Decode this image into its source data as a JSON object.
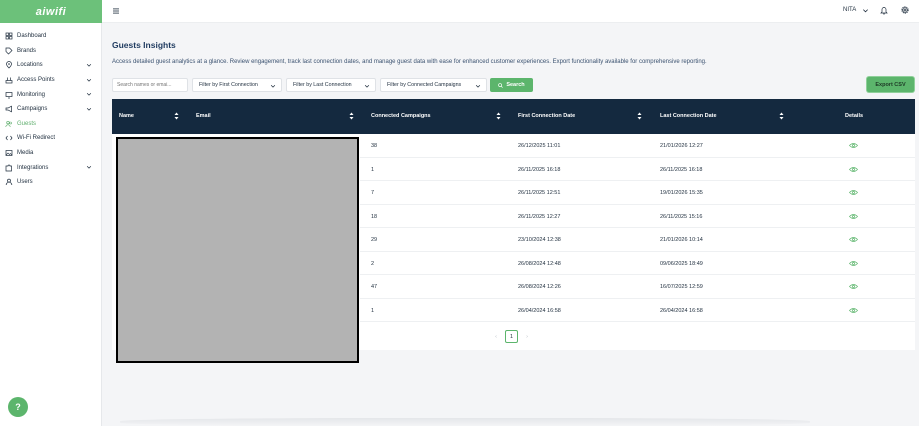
{
  "brand": {
    "name": "aiwifi",
    "accent": "#5cb56c",
    "header_bg": "#14293f"
  },
  "sidebar": {
    "items": [
      {
        "label": "Dashboard",
        "icon": "grid-icon",
        "has_children": false,
        "active": false
      },
      {
        "label": "Brands",
        "icon": "tag-icon",
        "has_children": false,
        "active": false
      },
      {
        "label": "Locations",
        "icon": "location-pin-icon",
        "has_children": true,
        "active": false
      },
      {
        "label": "Access Points",
        "icon": "router-icon",
        "has_children": true,
        "active": false
      },
      {
        "label": "Monitoring",
        "icon": "monitor-icon",
        "has_children": true,
        "active": false
      },
      {
        "label": "Campaigns",
        "icon": "megaphone-icon",
        "has_children": true,
        "active": false
      },
      {
        "label": "Guests",
        "icon": "users-icon",
        "has_children": false,
        "active": true
      },
      {
        "label": "Wi-Fi Redirect",
        "icon": "redirect-icon",
        "has_children": false,
        "active": false
      },
      {
        "label": "Media",
        "icon": "image-icon",
        "has_children": false,
        "active": false
      },
      {
        "label": "Integrations",
        "icon": "puzzle-icon",
        "has_children": true,
        "active": false
      },
      {
        "label": "Users",
        "icon": "user-icon",
        "has_children": false,
        "active": false
      }
    ],
    "help_label": "?"
  },
  "topbar": {
    "user_name": "NITA",
    "menu_icon": "hamburger-icon",
    "notification_icon": "bell-icon",
    "settings_icon": "gear-icon"
  },
  "page": {
    "title": "Guests Insights",
    "description": "Access detailed guest analytics at a glance. Review engagement, track last connection dates, and manage guest data with ease for enhanced customer experiences. Export functionality available for comprehensive reporting."
  },
  "filters": {
    "search_placeholder": "Search names or emai...",
    "first_connection": "Filter by First Connection",
    "last_connection": "Filter by Last Connection",
    "connected_campaigns": "Filter by Connected Campaigns",
    "search_button": "Search",
    "export_button": "Export CSV"
  },
  "table": {
    "columns": [
      "Name",
      "Email",
      "Connected Campaigns",
      "First Connection Date",
      "Last Connection Date",
      "Details"
    ],
    "rows": [
      {
        "campaigns": "38",
        "first": "26/12/2025 11:01",
        "last": "21/01/2026 12:27"
      },
      {
        "campaigns": "1",
        "first": "26/11/2025 16:18",
        "last": "26/11/2025 16:18"
      },
      {
        "campaigns": "7",
        "first": "26/11/2025 12:51",
        "last": "19/01/2026 15:35"
      },
      {
        "campaigns": "18",
        "first": "26/11/2025 12:27",
        "last": "26/11/2025 15:16"
      },
      {
        "campaigns": "29",
        "first": "23/10/2024 12:38",
        "last": "21/01/2026 10:14"
      },
      {
        "campaigns": "2",
        "first": "26/08/2024 12:48",
        "last": "09/06/2025 18:49"
      },
      {
        "campaigns": "47",
        "first": "26/08/2024 12:26",
        "last": "16/07/2025 12:59"
      },
      {
        "campaigns": "1",
        "first": "26/04/2024 16:58",
        "last": "26/04/2024 16:58"
      }
    ]
  },
  "pagination": {
    "prev": "‹",
    "current": "1",
    "next": "›"
  }
}
